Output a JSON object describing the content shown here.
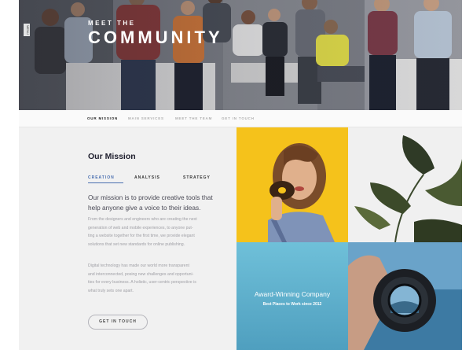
{
  "hero": {
    "kicker": "MEET THE",
    "title": "COMMUNITY",
    "side_tag": "MENU"
  },
  "nav": {
    "items": [
      "OUR MISSION",
      "MAIN SERVICES",
      "MEET THE TEAM",
      "GET IN TOUCH"
    ],
    "active": "OUR MISSION"
  },
  "mission": {
    "title": "Our Mission",
    "tabs": [
      "CREATION",
      "ANALYSIS",
      "STRATEGY"
    ],
    "active_tab": "CREATION",
    "lead_lines": [
      "Our mission is to provide creative tools that",
      "help anyone give a voice to their ideas."
    ],
    "paragraph1_lines": [
      "From the designers and engineers who are creating the next",
      "generation of web and mobile experiences, to anyone put-",
      "ting a website together for the first time, we provide elegant",
      "solutions that set new standards for online publishing."
    ],
    "paragraph2_lines": [
      "Digital technology has made our world more transparent",
      "and interconnected, posing new challenges and opportuni-",
      "ties for every business. A holistic, user-centric perspective is",
      "what truly sets one apart."
    ],
    "cta_label": "GET IN TOUCH"
  },
  "award": {
    "title": "Award-Winning Company",
    "subtitle": "Best Places to Work since 2012"
  },
  "colors": {
    "accent": "#4a6fb0",
    "yellow_tile": "#f5c21b",
    "blue_tile": "#5aaecb"
  }
}
